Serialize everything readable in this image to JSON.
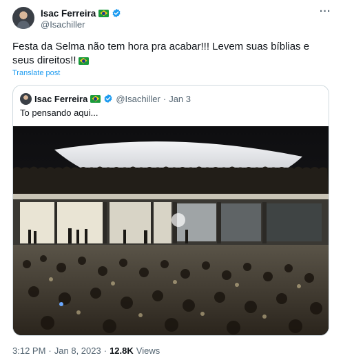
{
  "author": {
    "name": "Isac Ferreira",
    "handle": "@Isachiller",
    "flag_icon": "brazil-flag-icon",
    "verified_icon": "verified-badge-icon",
    "verified_color": "#1d9bf0"
  },
  "post": {
    "text": "Festa da Selma não tem hora pra acabar!!! Levem suas bíblias e seus direitos!!",
    "translate_label": "Translate post"
  },
  "quoted_post": {
    "author_name": "Isac Ferreira",
    "handle": "@Isachiller",
    "separator": "·",
    "date": "Jan 3",
    "text": "To pensando aqui...",
    "media_icon": "night-crowd-congress-photo"
  },
  "footer": {
    "time": "3:12 PM",
    "separator": "·",
    "date": "Jan 8, 2023",
    "separator2": "·",
    "views_count": "12.8K",
    "views_label": "Views"
  },
  "colors": {
    "link": "#1d9bf0",
    "secondary_text": "#536471",
    "border": "#cfd9de"
  }
}
